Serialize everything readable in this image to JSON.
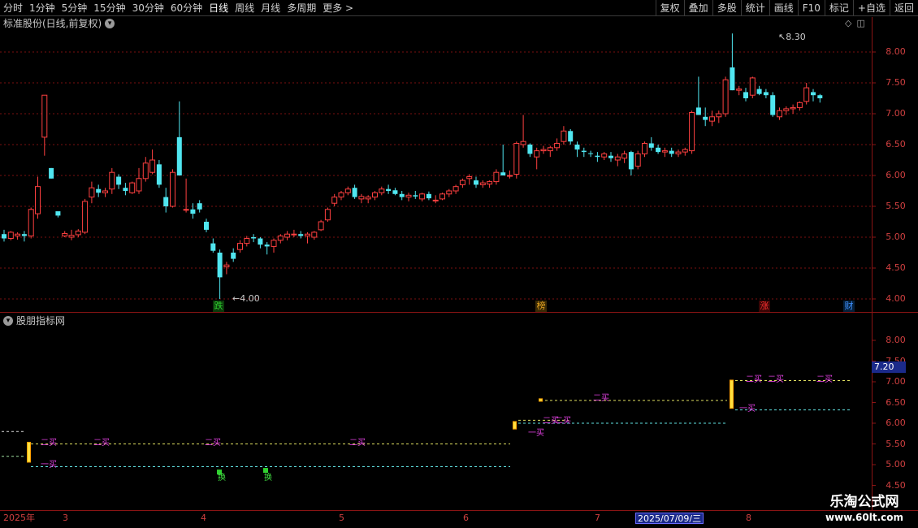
{
  "toolbar": {
    "periods": [
      "分时",
      "1分钟",
      "5分钟",
      "15分钟",
      "30分钟",
      "60分钟",
      "日线",
      "周线",
      "月线",
      "多周期",
      "更多 >"
    ],
    "active_period": "日线",
    "right_buttons": [
      "复权",
      "叠加",
      "多股",
      "统计",
      "画线",
      "F10",
      "标记",
      "+自选",
      "返回"
    ]
  },
  "main_chart": {
    "title": "标准股份(日线,前复权)",
    "high_label": "8.30",
    "low_label": "4.00",
    "y_ticks": [
      "8.00",
      "7.50",
      "7.00",
      "6.50",
      "6.00",
      "5.50",
      "5.00",
      "4.50",
      "4.00"
    ],
    "events": [
      {
        "label": "跌",
        "color": "#30d030"
      },
      {
        "label": "榜",
        "color": "#e0a020"
      },
      {
        "label": "涨",
        "color": "#ff3030"
      },
      {
        "label": "财",
        "color": "#4090ff"
      }
    ]
  },
  "indicator": {
    "title": "股朋指标网",
    "y_ticks": [
      "8.00",
      "7.50",
      "7.00",
      "6.50",
      "6.00",
      "5.50",
      "5.00",
      "4.50"
    ],
    "current_value": "7.20",
    "buy1_label": "一买",
    "buy2_label": "二买",
    "huan_label": "换"
  },
  "x_axis": {
    "labels": [
      "2025年",
      "3",
      "4",
      "5",
      "6",
      "7",
      "8"
    ],
    "cursor_date": "2025/07/09/三"
  },
  "brand": {
    "name": "乐淘公式网",
    "url": "www.60lt.com"
  },
  "colors": {
    "up": "#ff4040",
    "down": "#50e6f0",
    "grid": "#7a1010",
    "border": "#8a1414"
  },
  "chart_data": {
    "type": "candlestick",
    "ylim": [
      3.85,
      8.45
    ],
    "candles": [
      [
        5.05,
        5.12,
        4.93,
        4.98
      ],
      [
        4.98,
        5.1,
        4.95,
        5.08
      ],
      [
        5.02,
        5.08,
        4.96,
        5.05
      ],
      [
        5.05,
        5.1,
        4.93,
        5.02
      ],
      [
        5.02,
        5.48,
        4.98,
        5.45
      ],
      [
        5.38,
        5.98,
        5.3,
        5.82
      ],
      [
        6.62,
        7.3,
        6.32,
        7.3
      ],
      [
        6.12,
        6.12,
        5.95,
        5.95
      ],
      [
        5.42,
        5.4,
        5.32,
        5.35
      ],
      [
        5.02,
        5.1,
        5.0,
        5.06
      ],
      [
        5.0,
        5.12,
        4.95,
        5.03
      ],
      [
        5.04,
        5.13,
        5.0,
        5.1
      ],
      [
        5.08,
        5.62,
        5.05,
        5.58
      ],
      [
        5.65,
        5.9,
        5.55,
        5.8
      ],
      [
        5.78,
        5.85,
        5.65,
        5.72
      ],
      [
        5.72,
        5.8,
        5.65,
        5.75
      ],
      [
        5.78,
        6.12,
        5.7,
        6.05
      ],
      [
        5.98,
        6.02,
        5.78,
        5.85
      ],
      [
        5.8,
        5.88,
        5.68,
        5.75
      ],
      [
        5.72,
        5.9,
        5.7,
        5.88
      ],
      [
        5.75,
        6.12,
        5.7,
        5.95
      ],
      [
        5.95,
        6.3,
        5.9,
        6.2
      ],
      [
        6.05,
        6.42,
        6.02,
        6.25
      ],
      [
        6.18,
        6.25,
        5.8,
        5.85
      ],
      [
        5.65,
        5.8,
        5.4,
        5.5
      ],
      [
        5.5,
        6.1,
        5.48,
        6.05
      ],
      [
        6.62,
        7.2,
        6.0,
        6.0
      ],
      [
        5.45,
        5.95,
        5.4,
        5.45
      ],
      [
        5.45,
        5.55,
        5.3,
        5.38
      ],
      [
        5.55,
        5.6,
        5.4,
        5.45
      ],
      [
        5.25,
        5.3,
        5.08,
        5.12
      ],
      [
        4.9,
        4.98,
        4.75,
        4.78
      ],
      [
        4.75,
        4.8,
        4.0,
        4.35
      ],
      [
        4.52,
        4.6,
        4.4,
        4.55
      ],
      [
        4.75,
        4.82,
        4.6,
        4.65
      ],
      [
        4.8,
        4.95,
        4.75,
        4.9
      ],
      [
        4.9,
        5.02,
        4.85,
        4.98
      ],
      [
        5.0,
        5.05,
        4.92,
        4.98
      ],
      [
        4.98,
        5.0,
        4.82,
        4.88
      ],
      [
        4.88,
        4.92,
        4.72,
        4.85
      ],
      [
        4.85,
        4.98,
        4.75,
        4.95
      ],
      [
        4.95,
        5.05,
        4.9,
        5.02
      ],
      [
        5.0,
        5.1,
        4.95,
        5.05
      ],
      [
        5.05,
        5.12,
        5.0,
        5.05
      ],
      [
        5.05,
        5.1,
        4.98,
        5.02
      ],
      [
        5.02,
        5.08,
        4.9,
        5.05
      ],
      [
        5.0,
        5.1,
        4.96,
        5.08
      ],
      [
        5.12,
        5.28,
        5.1,
        5.25
      ],
      [
        5.28,
        5.48,
        5.25,
        5.45
      ],
      [
        5.55,
        5.7,
        5.5,
        5.65
      ],
      [
        5.65,
        5.75,
        5.6,
        5.72
      ],
      [
        5.72,
        5.82,
        5.68,
        5.78
      ],
      [
        5.8,
        5.85,
        5.62,
        5.65
      ],
      [
        5.62,
        5.7,
        5.55,
        5.66
      ],
      [
        5.62,
        5.68,
        5.55,
        5.65
      ],
      [
        5.65,
        5.75,
        5.6,
        5.72
      ],
      [
        5.72,
        5.82,
        5.68,
        5.78
      ],
      [
        5.78,
        5.85,
        5.7,
        5.75
      ],
      [
        5.76,
        5.8,
        5.68,
        5.7
      ],
      [
        5.7,
        5.75,
        5.6,
        5.65
      ],
      [
        5.65,
        5.72,
        5.58,
        5.68
      ],
      [
        5.68,
        5.75,
        5.62,
        5.66
      ],
      [
        5.62,
        5.72,
        5.58,
        5.7
      ],
      [
        5.7,
        5.74,
        5.6,
        5.63
      ],
      [
        5.6,
        5.68,
        5.55,
        5.6
      ],
      [
        5.62,
        5.72,
        5.6,
        5.7
      ],
      [
        5.7,
        5.78,
        5.65,
        5.75
      ],
      [
        5.75,
        5.85,
        5.7,
        5.82
      ],
      [
        5.85,
        5.95,
        5.8,
        5.92
      ],
      [
        5.95,
        6.02,
        5.85,
        5.98
      ],
      [
        5.92,
        5.98,
        5.8,
        5.85
      ],
      [
        5.85,
        5.92,
        5.8,
        5.88
      ],
      [
        5.86,
        5.92,
        5.8,
        5.9
      ],
      [
        5.9,
        6.1,
        5.85,
        6.05
      ],
      [
        6.05,
        6.5,
        6.0,
        6.0
      ],
      [
        6.0,
        6.08,
        5.95,
        6.0
      ],
      [
        6.02,
        6.55,
        5.95,
        6.52
      ],
      [
        6.5,
        6.98,
        6.45,
        6.55
      ],
      [
        6.5,
        6.52,
        6.3,
        6.35
      ],
      [
        6.3,
        6.45,
        6.1,
        6.4
      ],
      [
        6.4,
        6.48,
        6.35,
        6.42
      ],
      [
        6.4,
        6.48,
        6.3,
        6.45
      ],
      [
        6.45,
        6.6,
        6.4,
        6.52
      ],
      [
        6.55,
        6.8,
        6.5,
        6.72
      ],
      [
        6.72,
        6.75,
        6.5,
        6.55
      ],
      [
        6.5,
        6.55,
        6.3,
        6.42
      ],
      [
        6.4,
        6.45,
        6.3,
        6.38
      ],
      [
        6.36,
        6.4,
        6.3,
        6.35
      ],
      [
        6.32,
        6.38,
        6.22,
        6.3
      ],
      [
        6.3,
        6.38,
        6.25,
        6.35
      ],
      [
        6.32,
        6.38,
        6.22,
        6.28
      ],
      [
        6.25,
        6.35,
        6.15,
        6.3
      ],
      [
        6.28,
        6.4,
        6.2,
        6.35
      ],
      [
        6.38,
        6.4,
        6.0,
        6.1
      ],
      [
        6.15,
        6.4,
        6.1,
        6.35
      ],
      [
        6.35,
        6.55,
        6.3,
        6.52
      ],
      [
        6.52,
        6.62,
        6.4,
        6.45
      ],
      [
        6.45,
        6.5,
        6.35,
        6.38
      ],
      [
        6.38,
        6.45,
        6.3,
        6.4
      ],
      [
        6.4,
        6.45,
        6.3,
        6.35
      ],
      [
        6.35,
        6.42,
        6.3,
        6.38
      ],
      [
        6.38,
        6.45,
        6.32,
        6.42
      ],
      [
        6.4,
        7.05,
        6.35,
        7.02
      ],
      [
        7.1,
        7.6,
        7.0,
        6.98
      ],
      [
        6.95,
        7.1,
        6.8,
        6.9
      ],
      [
        6.88,
        7.05,
        6.8,
        6.95
      ],
      [
        6.95,
        7.05,
        6.85,
        7.0
      ],
      [
        7.0,
        7.6,
        6.95,
        7.55
      ],
      [
        7.75,
        8.3,
        7.38,
        7.38
      ],
      [
        7.38,
        7.45,
        7.3,
        7.4
      ],
      [
        7.35,
        7.42,
        7.2,
        7.25
      ],
      [
        7.3,
        7.6,
        7.25,
        7.58
      ],
      [
        7.4,
        7.45,
        7.3,
        7.32
      ],
      [
        7.35,
        7.4,
        7.25,
        7.3
      ],
      [
        7.3,
        7.35,
        6.95,
        6.98
      ],
      [
        6.95,
        7.1,
        6.9,
        7.05
      ],
      [
        7.05,
        7.12,
        6.98,
        7.08
      ],
      [
        7.08,
        7.15,
        7.0,
        7.1
      ],
      [
        7.1,
        7.2,
        7.05,
        7.18
      ],
      [
        7.2,
        7.5,
        7.15,
        7.42
      ],
      [
        7.35,
        7.4,
        7.2,
        7.3
      ],
      [
        7.3,
        7.32,
        7.18,
        7.25
      ]
    ]
  }
}
